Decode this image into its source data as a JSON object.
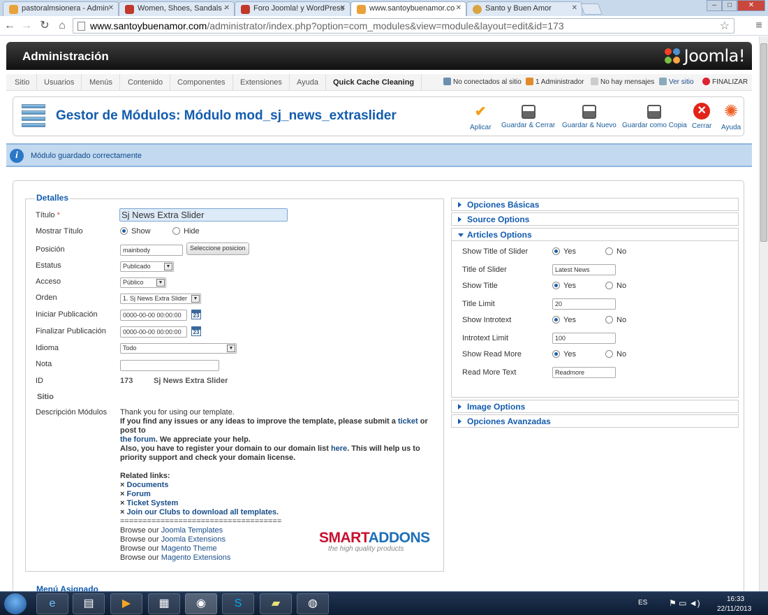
{
  "browser": {
    "tabs": [
      {
        "title": "pastoralmsionera - Admin",
        "color": "#e9a23b"
      },
      {
        "title": "Women, Shoes, Sandals -",
        "color": "#c0392b"
      },
      {
        "title": "Foro Joomla! y WordPress",
        "color": "#c0392b"
      },
      {
        "title": "www.santoybuenamor.co",
        "color": "#e9a23b"
      },
      {
        "title": "Santo y Buen Amor",
        "color": "#d9a441"
      }
    ],
    "active_tab": 3,
    "url_domain": "www.santoybuenamor.com",
    "url_path": "/administrator/index.php?option=com_modules&view=module&layout=edit&id=173",
    "window_controls": [
      "–",
      "□",
      "✕"
    ]
  },
  "header": {
    "title": "Administración",
    "logo_text": "Joomla!"
  },
  "menu": {
    "items": [
      "Sitio",
      "Usuarios",
      "Menús",
      "Contenido",
      "Componentes",
      "Extensiones",
      "Ayuda",
      "Quick Cache Cleaning"
    ],
    "status": {
      "visitors": "No conectados al sitio",
      "admins": "1 Administrador",
      "messages": "No hay mensajes",
      "view_site": "Ver sitio",
      "logout": "FINALIZAR"
    }
  },
  "page": {
    "title": "Gestor de Módulos: Módulo mod_sj_news_extraslider",
    "buttons": {
      "apply": "Aplicar",
      "save_close": "Guardar & Cerrar",
      "save_new": "Guardar & Nuevo",
      "save_copy": "Guardar como Copia",
      "close": "Cerrar",
      "help": "Ayuda"
    },
    "message": "Módulo guardado correctamente"
  },
  "details": {
    "legend": "Detalles",
    "labels": {
      "title": "Título",
      "required_mark": "*",
      "show_title": "Mostrar Título",
      "position": "Posición",
      "status": "Estatus",
      "access": "Acceso",
      "order": "Orden",
      "publish_up": "Iniciar Publicación",
      "publish_down": "Finalizar Publicación",
      "language": "Idioma",
      "note": "Nota",
      "id": "ID",
      "site": "Sitio",
      "description": "Descripción Módulos"
    },
    "values": {
      "title": "Sj News Extra Slider",
      "show_title_options": [
        "Show",
        "Hide"
      ],
      "show_title_selected": "Show",
      "position": "mainbody",
      "select_position_btn": "Seleccione posicion",
      "status": "Publicado",
      "access": "Público",
      "order": "1. Sj News Extra Slider",
      "publish_up": "0000-00-00 00:00:00",
      "publish_down": "0000-00-00 00:00:00",
      "calendar_label": "23",
      "language": "Todo",
      "note": "",
      "id": "173",
      "id_name": "Sj News Extra Slider"
    },
    "description": {
      "p1a": "Thank you for using our template.",
      "p1b": "If you find any issues or any ideas to improve the template, please submit a ",
      "ticket": "ticket",
      "p1c": " or post to ",
      "forum": "the forum",
      "p1d": ". We appreciate your help.",
      "p1e": "Also, you have to register your domain to our domain list ",
      "here": "here",
      "p1f": ". This will help us to priority support and check your domain license.",
      "related": "Related links:",
      "bullet": "×",
      "links": [
        "Documents",
        "Forum",
        "Ticket System",
        "Join our Clubs to download all templates."
      ],
      "separator": "====================================",
      "browse_prefix": "Browse our ",
      "browse": [
        "Joomla Templates",
        "Joomla Extensions",
        "Magento Theme",
        "Magento Extensions"
      ],
      "brand1": "SMART",
      "brand2": "ADDONS",
      "tagline": "the high quality products"
    },
    "next_legend": "Menú Asignado"
  },
  "options": {
    "sections": [
      "Opciones Básicas",
      "Source Options",
      "Articles Options",
      "Image Options",
      "Opciones Avanzadas"
    ],
    "open_section": "Articles Options",
    "yes": "Yes",
    "no": "No",
    "fields": {
      "show_title_of_slider": "Show Title of Slider",
      "title_of_slider": "Title of Slider",
      "title_of_slider_value": "Latest News",
      "show_title": "Show Title",
      "title_limit": "Title Limit",
      "title_limit_value": "20",
      "show_introtext": "Show Introtext",
      "introtext_limit": "Introtext Limit",
      "introtext_limit_value": "100",
      "show_read_more": "Show Read More",
      "read_more_text": "Read More Text",
      "read_more_text_value": "Readmore"
    }
  },
  "taskbar": {
    "lang": "ES",
    "time": "16:33",
    "date": "22/11/2013"
  }
}
